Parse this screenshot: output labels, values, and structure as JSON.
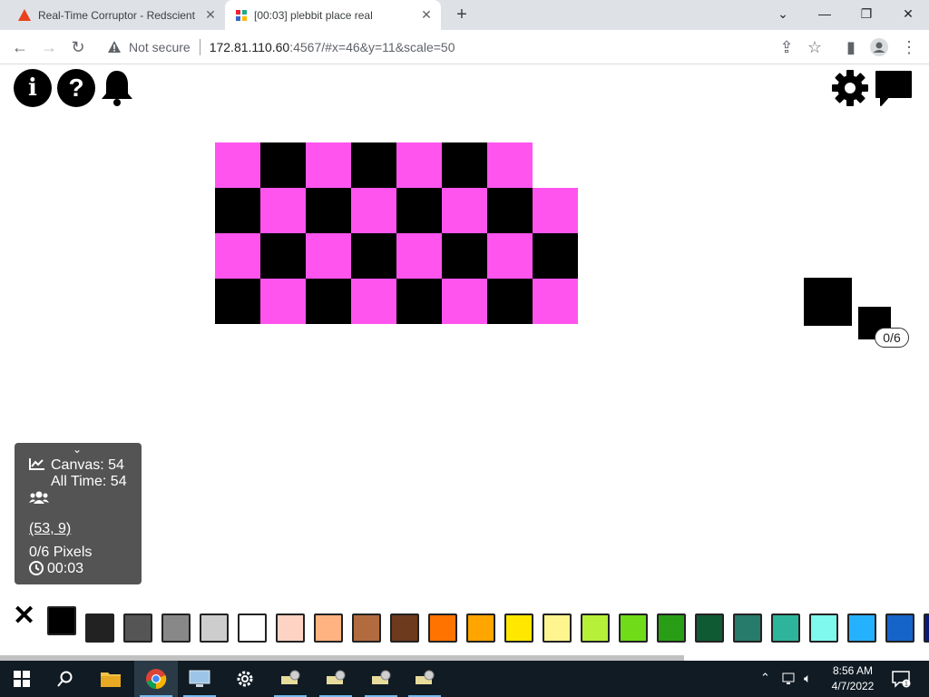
{
  "browser": {
    "tabs": [
      {
        "title": "Real-Time Corruptor - Redscient",
        "active": false
      },
      {
        "title": "[00:03] plebbit place real",
        "active": true
      }
    ],
    "address": {
      "security_label": "Not secure",
      "host": "172.81.110.60",
      "path": ":4567/#x=46&y=11&scale=50"
    }
  },
  "top_icons": {
    "left": [
      "info-icon",
      "help-icon",
      "bell-icon"
    ],
    "right": [
      "gear-icon",
      "chat-icon"
    ]
  },
  "canvas": {
    "pink": "#ff55ee",
    "black": "#000000",
    "rows": [
      "PBPBPBP-",
      "BPBPBPBP",
      "PBPBPBPB",
      "BPBPBPBP"
    ]
  },
  "cursor_preview": {
    "counter": "0/6"
  },
  "info": {
    "canvas_label": "Canvas: 54",
    "alltime_label": "All Time: 54",
    "coords": "(53, 9)",
    "pixels": "0/6 Pixels",
    "timer": "00:03"
  },
  "palette": {
    "selected_index": 0,
    "colors": [
      "#000000",
      "#222222",
      "#555555",
      "#888888",
      "#cdcdcd",
      "#ffffff",
      "#ffd3c4",
      "#ffb380",
      "#b26b3f",
      "#6e3a1d",
      "#ff7400",
      "#ffa500",
      "#ffe700",
      "#fff58f",
      "#b7f039",
      "#6fdb19",
      "#2a9d16",
      "#0f5a32",
      "#267b6a",
      "#2eb49b",
      "#7ff8ee",
      "#26b1ff",
      "#1564c9",
      "#0b1a78"
    ]
  },
  "taskbar": {
    "time": "8:56 AM",
    "date": "4/7/2022"
  }
}
